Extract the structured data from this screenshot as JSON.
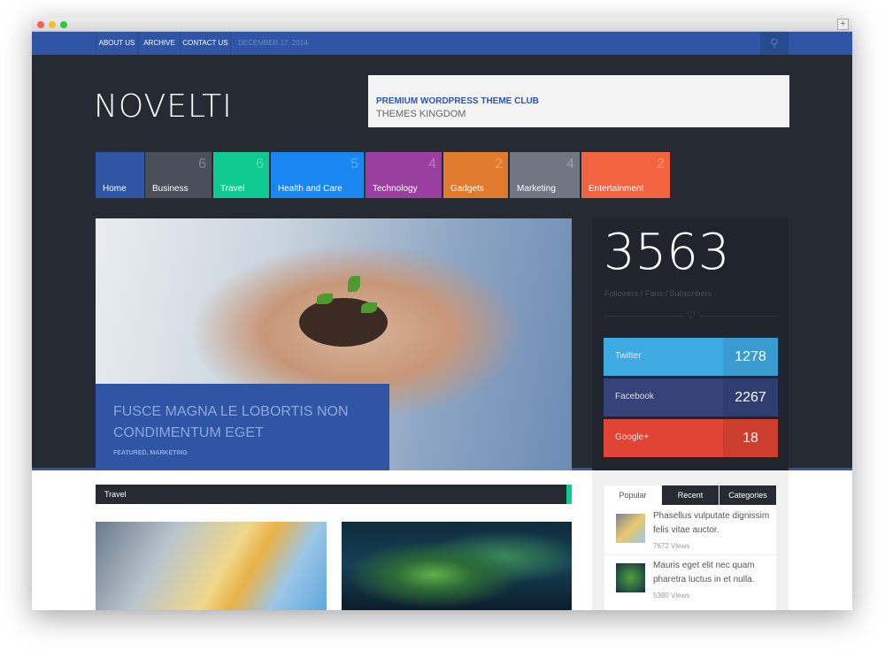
{
  "topnav": {
    "links": [
      "ABOUT US",
      "ARCHIVE",
      "CONTACT US"
    ],
    "date": "DECEMBER 17, 2014",
    "search_icon": "search-icon"
  },
  "header": {
    "logo": "NOVELTI",
    "ad_line1": "PREMIUM WORDPRESS THEME CLUB",
    "ad_line2": "THEMES KINGDOM"
  },
  "categories": [
    {
      "label": "Home",
      "count": "",
      "color": "#2f55a4"
    },
    {
      "label": "Business",
      "count": "6",
      "color": "#4a4f5a"
    },
    {
      "label": "Travel",
      "count": "6",
      "color": "#0fcb92"
    },
    {
      "label": "Health and Care",
      "count": "5",
      "color": "#1a86f0"
    },
    {
      "label": "Technology",
      "count": "4",
      "color": "#9a3fa0"
    },
    {
      "label": "Gadgets",
      "count": "2",
      "color": "#e07a2c"
    },
    {
      "label": "Marketing",
      "count": "4",
      "color": "#717680"
    },
    {
      "label": "Entertainment",
      "count": "2",
      "color": "#f26440"
    }
  ],
  "featured": {
    "title": "FUSCE MAGNA LE LOBORTIS NON CONDIMENTUM EGET",
    "meta": "FEATURED, MARKETING"
  },
  "followers": {
    "total": "3563",
    "label": "Followers / Fans / Subscribers",
    "networks": [
      {
        "name": "Twitter",
        "count": "1278",
        "color": "#3fa9e2"
      },
      {
        "name": "Facebook",
        "count": "2267",
        "color": "#35437a"
      },
      {
        "name": "Google+",
        "count": "18",
        "color": "#e04434"
      }
    ]
  },
  "section": {
    "title": "Travel"
  },
  "sidebar": {
    "tabs": [
      "Popular",
      "Recent",
      "Categories"
    ],
    "posts": [
      {
        "title": "Phasellus vulputate dignissim felis vitae auctor.",
        "views": "7672 Views"
      },
      {
        "title": "Mauris eget elit nec quam pharetra luctus in et nulla.",
        "views": "5380 Views"
      }
    ]
  }
}
